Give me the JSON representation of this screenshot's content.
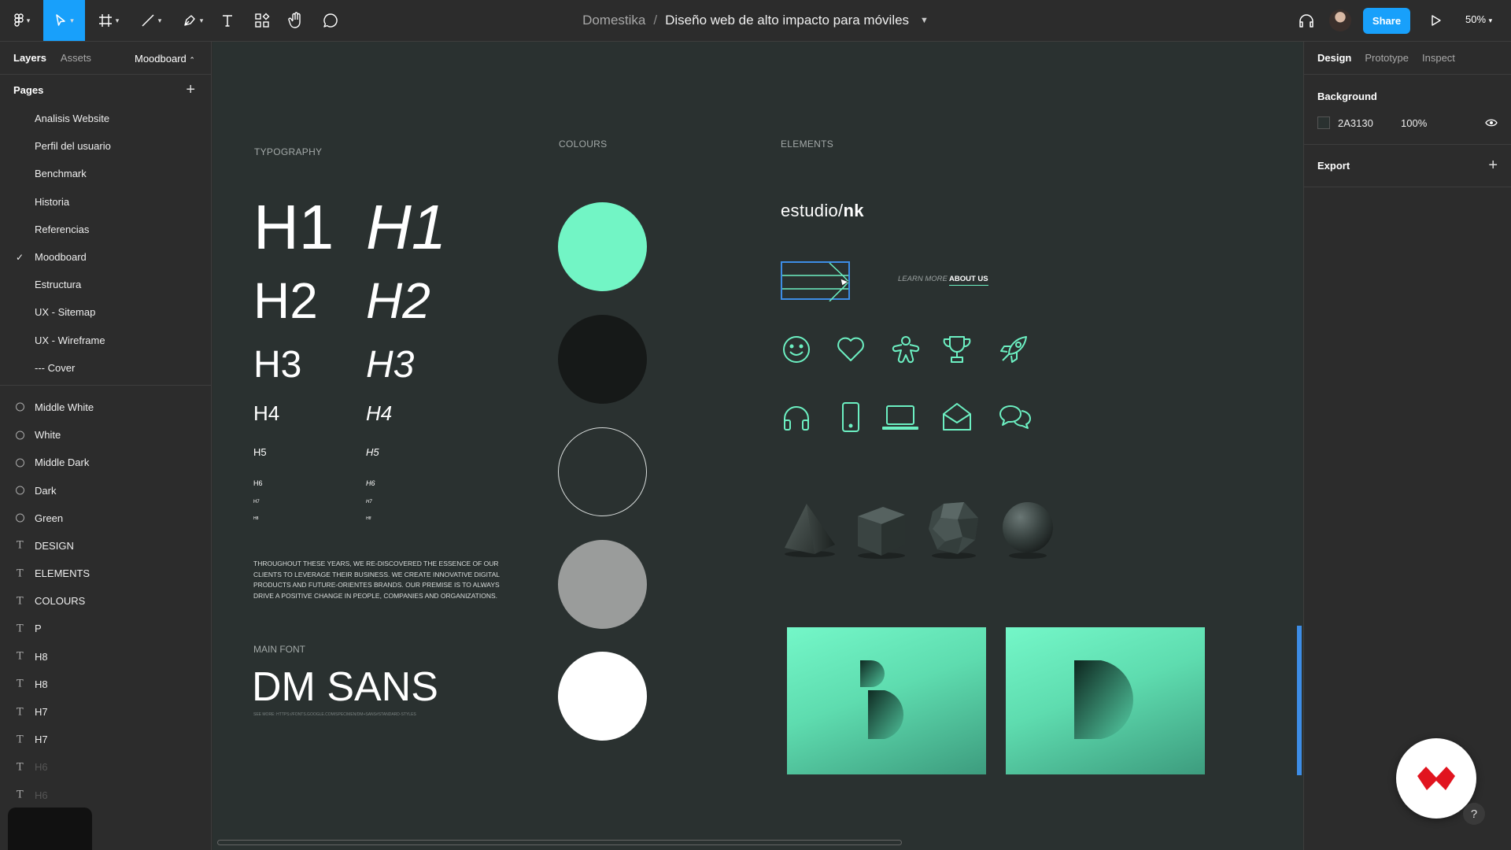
{
  "toolbar": {
    "tools": [
      "figma-menu",
      "move",
      "frame",
      "line",
      "pen",
      "text",
      "components",
      "hand",
      "comment"
    ]
  },
  "breadcrumb": {
    "team": "Domestika",
    "separator": "/",
    "file": "Diseño web de alto impacto para móviles"
  },
  "header_right": {
    "share_label": "Share",
    "zoom": "50%"
  },
  "left_panel": {
    "tabs": [
      "Layers",
      "Assets"
    ],
    "current_page": "Moodboard",
    "pages_title": "Pages",
    "pages": [
      {
        "label": "Analisis Website",
        "checked": false
      },
      {
        "label": "Perfil del usuario",
        "checked": false
      },
      {
        "label": "Benchmark",
        "checked": false
      },
      {
        "label": "Historia",
        "checked": false
      },
      {
        "label": "Referencias",
        "checked": false
      },
      {
        "label": "Moodboard",
        "checked": true
      },
      {
        "label": "Estructura",
        "checked": false
      },
      {
        "label": "UX - Sitemap",
        "checked": false
      },
      {
        "label": "UX - Wireframe",
        "checked": false
      },
      {
        "label": "--- Cover",
        "checked": false
      }
    ],
    "layers": [
      {
        "label": "Middle White",
        "icon": "ellipse-icon"
      },
      {
        "label": "White",
        "icon": "ellipse-icon"
      },
      {
        "label": "Middle Dark",
        "icon": "ellipse-icon"
      },
      {
        "label": "Dark",
        "icon": "ellipse-icon"
      },
      {
        "label": "Green",
        "icon": "ellipse-icon"
      },
      {
        "label": "DESIGN",
        "icon": "text-icon"
      },
      {
        "label": "ELEMENTS",
        "icon": "text-icon"
      },
      {
        "label": "COLOURS",
        "icon": "text-icon"
      },
      {
        "label": "P",
        "icon": "text-icon"
      },
      {
        "label": "H8",
        "icon": "text-icon"
      },
      {
        "label": "H8",
        "icon": "text-icon"
      },
      {
        "label": "H7",
        "icon": "text-icon"
      },
      {
        "label": "H7",
        "icon": "text-icon"
      },
      {
        "label": "H6",
        "icon": "text-icon"
      },
      {
        "label": "H6",
        "icon": "text-icon"
      }
    ]
  },
  "canvas": {
    "background": "#2A3130",
    "sections": {
      "typography": "TYPOGRAPHY",
      "colours": "COLOURS",
      "elements": "ELEMENTS"
    },
    "headings": [
      "H1",
      "H2",
      "H3",
      "H4",
      "H5",
      "H6",
      "H7",
      "H8"
    ],
    "paragraph": "THROUGHOUT THESE YEARS, WE RE-DISCOVERED THE ESSENCE OF OUR CLIENTS TO LEVERAGE THEIR BUSINESS. WE CREATE INNOVATIVE DIGITAL PRODUCTS AND FUTURE-ORIENTES BRANDS. OUR PREMISE IS TO ALWAYS DRIVE A POSITIVE CHANGE IN PEOPLE, COMPANIES AND ORGANIZATIONS.",
    "main_font_label": "MAIN FONT",
    "main_font_name": "DM SANS",
    "main_font_link": "SEE MORE: HTTPS://FONTS.GOOGLE.COM/SPECIMEN/DM+SANS#STANDARD-STYLES",
    "swatches": [
      {
        "name": "Green",
        "color": "#72F5C5"
      },
      {
        "name": "Dark",
        "color": "#161918"
      },
      {
        "name": "Middle Dark",
        "color": "transparent"
      },
      {
        "name": "Middle White",
        "color": "#9A9C9B"
      },
      {
        "name": "White",
        "color": "#FFFFFF"
      }
    ],
    "accent": "#6CF0C2",
    "brand_logo": {
      "prefix": "estudio/",
      "suffix": "nk"
    },
    "learn_more": "LEARN MORE",
    "about_us": "ABOUT US",
    "icons_row1": [
      "smile-icon",
      "heart-icon",
      "gingerbread-icon",
      "trophy-icon",
      "rocket-icon"
    ],
    "icons_row2": [
      "headphones-icon",
      "smartphone-icon",
      "laptop-icon",
      "mail-open-icon",
      "chat-bubbles-icon"
    ],
    "shapes_3d": [
      "pyramid",
      "cube",
      "polyhedron",
      "sphere"
    ],
    "tiles": [
      "letter-b-tile",
      "letter-d-tile"
    ]
  },
  "right_panel": {
    "tabs": [
      "Design",
      "Prototype",
      "Inspect"
    ],
    "background_title": "Background",
    "background_hex": "2A3130",
    "background_opacity": "100%",
    "export_title": "Export"
  }
}
